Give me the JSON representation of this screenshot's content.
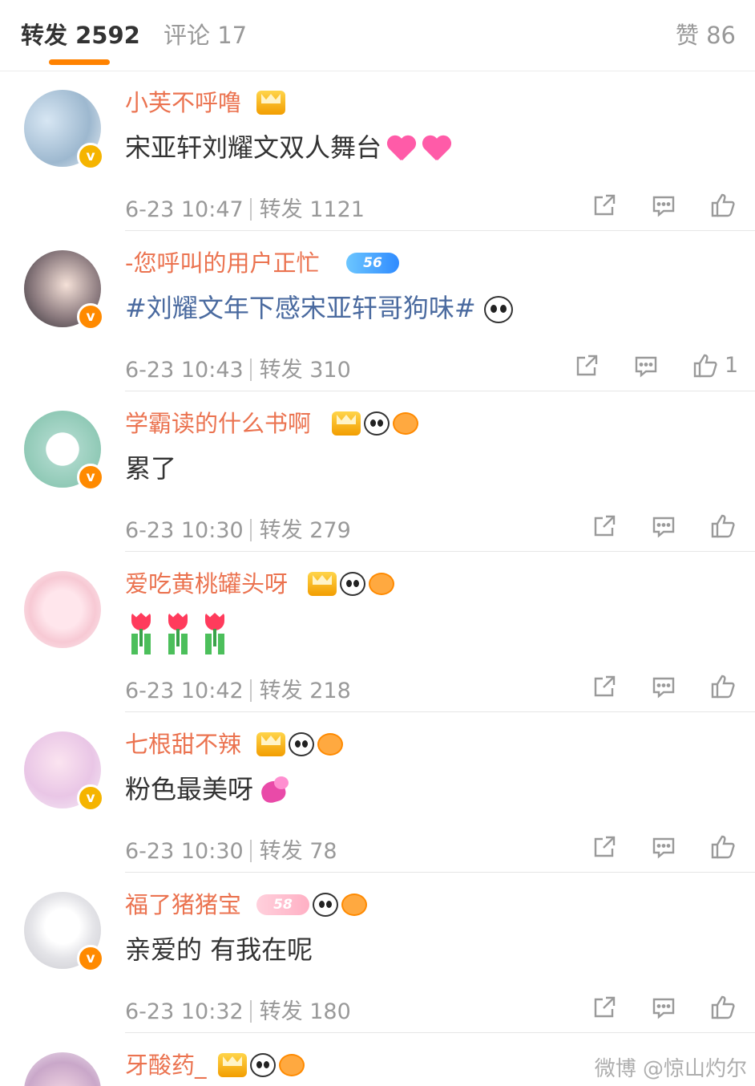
{
  "tabs": {
    "repost": "转发 2592",
    "comment": "评论 17",
    "like": "赞 86"
  },
  "accent_color": "#ff8200",
  "name_color": "#eb7350",
  "items": [
    {
      "name": "小芙不呼噜",
      "text": "宋亚轩刘耀文双人舞台",
      "time": "6-23 10:47",
      "repost": "转发 1121",
      "likes": ""
    },
    {
      "name": "-您呼叫的用户正忙",
      "text": "#刘耀文年下感宋亚轩哥狗味#",
      "time": "6-23 10:43",
      "repost": "转发 310",
      "likes": "1",
      "level": "56"
    },
    {
      "name": "学霸读的什么书啊",
      "text": "累了",
      "time": "6-23 10:30",
      "repost": "转发 279",
      "likes": ""
    },
    {
      "name": "爱吃黄桃罐头呀",
      "text": "",
      "time": "6-23 10:42",
      "repost": "转发 218",
      "likes": ""
    },
    {
      "name": "七根甜不辣",
      "text": "粉色最美呀",
      "time": "6-23 10:30",
      "repost": "转发 78",
      "likes": ""
    },
    {
      "name": "福了猪猪宝",
      "text": "亲爱的 有我在呢",
      "time": "6-23 10:32",
      "repost": "转发 180",
      "likes": "",
      "level": "58"
    },
    {
      "name": "牙酸药_",
      "text": "",
      "time": "",
      "repost": "",
      "likes": ""
    }
  ],
  "badge_v": "v",
  "watermark": "微博 @惊山灼尔",
  "icons": [
    "share-icon",
    "comment-icon",
    "like-icon",
    "panda-emoji-icon",
    "heart-emoji-icon",
    "tulip-emoji-icon",
    "crown-badge-icon"
  ]
}
